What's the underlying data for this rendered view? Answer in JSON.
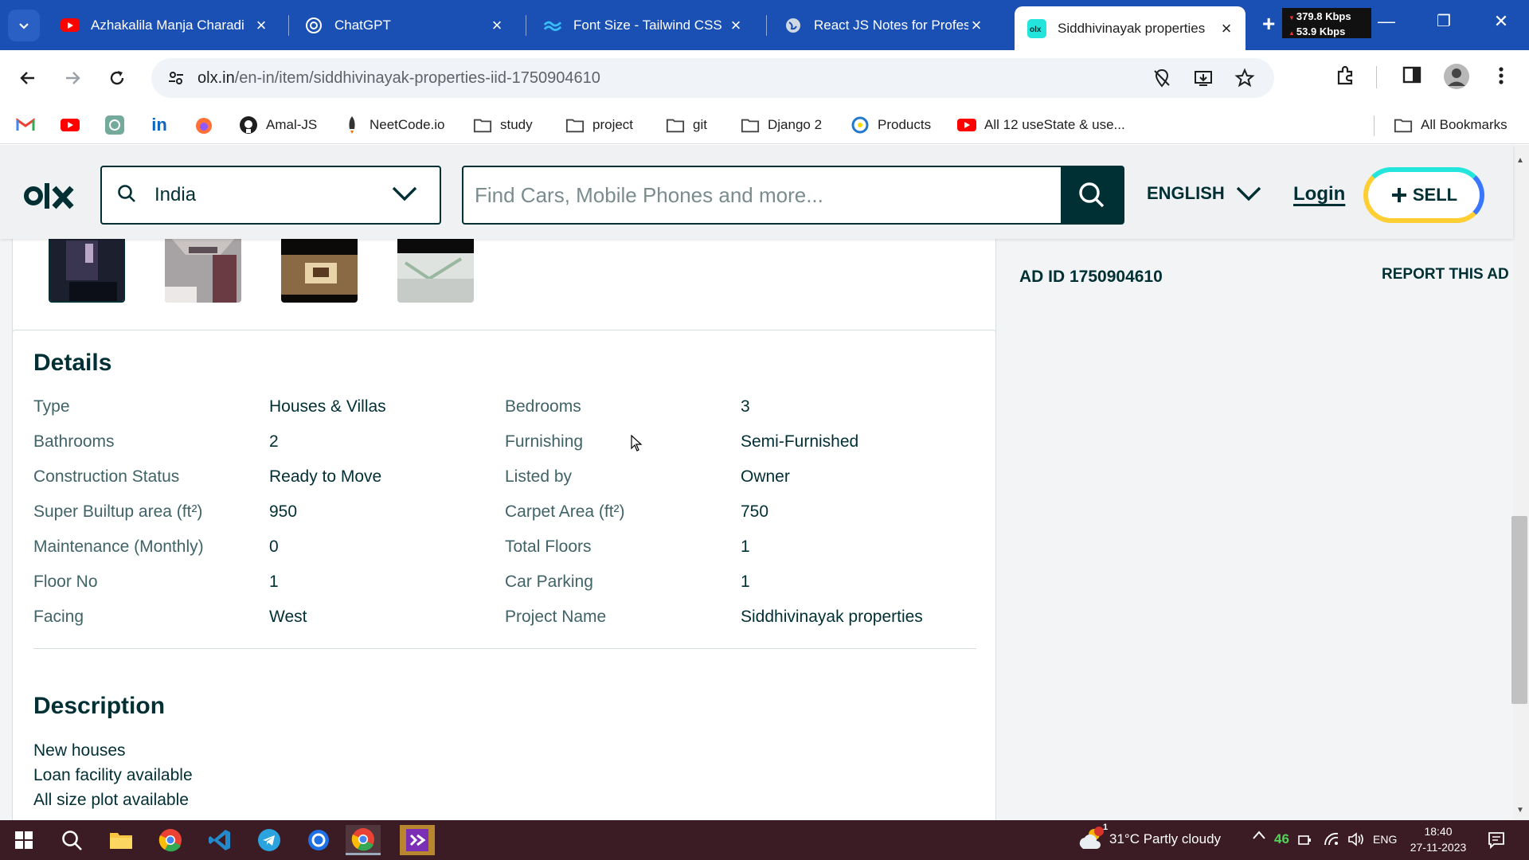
{
  "browser": {
    "tabs": [
      {
        "label": "Azhakalila Manja Charadi",
        "icon": "youtube-icon",
        "active": false
      },
      {
        "label": "ChatGPT",
        "icon": "chatgpt-icon",
        "active": false
      },
      {
        "label": "Font Size - Tailwind CSS",
        "icon": "tailwind-icon",
        "active": false
      },
      {
        "label": "React JS Notes for Profes",
        "icon": "globe-icon",
        "active": false
      },
      {
        "label": "Siddhivinayak properties",
        "icon": "olx-icon",
        "active": true
      }
    ],
    "netspeed": {
      "down": "379.8 Kbps",
      "up": "53.9 Kbps"
    },
    "url_host": "olx.in",
    "url_path": "/en-in/item/siddhivinayak-properties-iid-1750904610"
  },
  "bookmarks": [
    {
      "label": "",
      "icon": "gmail-icon"
    },
    {
      "label": "",
      "icon": "youtube-icon"
    },
    {
      "label": "",
      "icon": "chatgpt-icon"
    },
    {
      "label": "",
      "icon": "linkedin-icon"
    },
    {
      "label": "",
      "icon": "firefox-icon"
    },
    {
      "label": "Amal-JS",
      "icon": "github-icon"
    },
    {
      "label": "NeetCode.io",
      "icon": "rocket-icon"
    },
    {
      "label": "study",
      "icon": "folder-icon"
    },
    {
      "label": "project",
      "icon": "folder-icon"
    },
    {
      "label": "git",
      "icon": "folder-icon"
    },
    {
      "label": "Django 2",
      "icon": "folder-icon"
    },
    {
      "label": "Products",
      "icon": "contentful-icon"
    },
    {
      "label": "All 12 useState & use...",
      "icon": "youtube-icon"
    },
    {
      "label": "All Bookmarks",
      "icon": "folder-icon"
    }
  ],
  "olx": {
    "location": "India",
    "search_placeholder": "Find Cars, Mobile Phones and more...",
    "language": "ENGLISH",
    "login": "Login",
    "sell": "SELL",
    "ad_id": "AD ID 1750904610",
    "report": "REPORT THIS AD",
    "details_title": "Details",
    "details": [
      {
        "k1": "Type",
        "v1": "Houses & Villas",
        "k2": "Bedrooms",
        "v2": "3"
      },
      {
        "k1": "Bathrooms",
        "v1": "2",
        "k2": "Furnishing",
        "v2": "Semi-Furnished"
      },
      {
        "k1": "Construction Status",
        "v1": "Ready to Move",
        "k2": "Listed by",
        "v2": "Owner"
      },
      {
        "k1": "Super Builtup area (ft²)",
        "v1": "950",
        "k2": "Carpet Area (ft²)",
        "v2": "750"
      },
      {
        "k1": "Maintenance (Monthly)",
        "v1": "0",
        "k2": "Total Floors",
        "v2": "1"
      },
      {
        "k1": "Floor No",
        "v1": "1",
        "k2": "Car Parking",
        "v2": "1"
      },
      {
        "k1": "Facing",
        "v1": "West",
        "k2": "Project Name",
        "v2": "Siddhivinayak properties"
      }
    ],
    "description_title": "Description",
    "description_lines": [
      "New houses",
      "Loan facility available",
      "All size plot available"
    ]
  },
  "taskbar": {
    "weather": "31°C  Partly cloudy",
    "weather_badge": "1",
    "battery": "46",
    "lang": "ENG",
    "time": "18:40",
    "date": "27-11-2023"
  },
  "colors": {
    "olx_dark": "#002f34",
    "chrome_blue": "#1a4fb4",
    "taskbar": "#3b1b24"
  }
}
